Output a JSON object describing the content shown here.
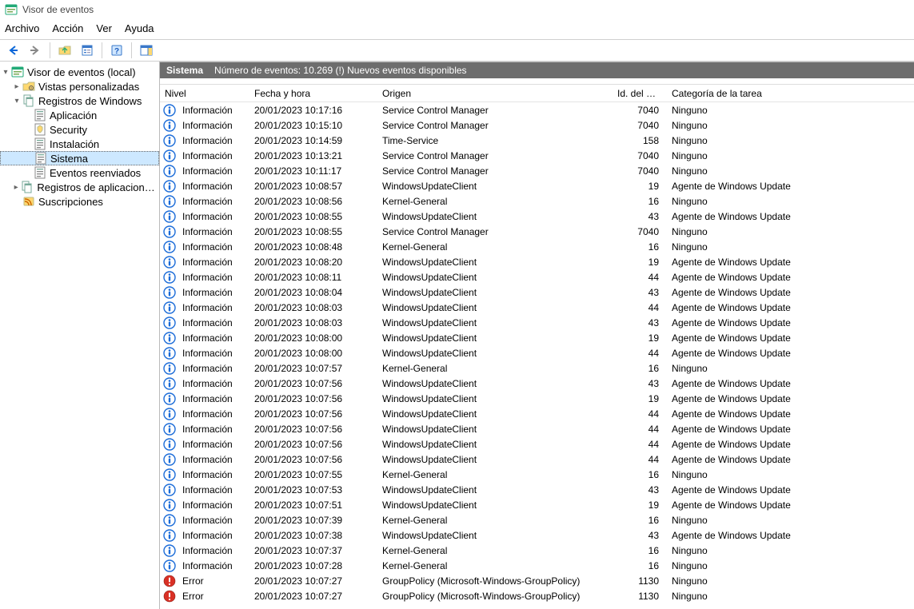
{
  "window": {
    "title": "Visor de eventos"
  },
  "menu": {
    "file": "Archivo",
    "action": "Acción",
    "view": "Ver",
    "help": "Ayuda"
  },
  "tree": {
    "root": "Visor de eventos (local)",
    "custom_views": "Vistas personalizadas",
    "windows_logs": "Registros de Windows",
    "application": "Aplicación",
    "security": "Security",
    "setup": "Instalación",
    "system": "Sistema",
    "forwarded": "Eventos reenviados",
    "app_services": "Registros de aplicaciones y s",
    "subscriptions": "Suscripciones"
  },
  "list_header": {
    "title": "Sistema",
    "count": "Número de eventos: 10.269 (!) Nuevos eventos disponibles"
  },
  "columns": {
    "level": "Nivel",
    "date": "Fecha y hora",
    "origin": "Origen",
    "event_id": "Id. del ev...",
    "category": "Categoría de la tarea"
  },
  "level_labels": {
    "info": "Información",
    "error": "Error"
  },
  "events": [
    {
      "lvl": "info",
      "date": "20/01/2023 10:17:16",
      "origin": "Service Control Manager",
      "id": "7040",
      "cat": "Ninguno"
    },
    {
      "lvl": "info",
      "date": "20/01/2023 10:15:10",
      "origin": "Service Control Manager",
      "id": "7040",
      "cat": "Ninguno"
    },
    {
      "lvl": "info",
      "date": "20/01/2023 10:14:59",
      "origin": "Time-Service",
      "id": "158",
      "cat": "Ninguno"
    },
    {
      "lvl": "info",
      "date": "20/01/2023 10:13:21",
      "origin": "Service Control Manager",
      "id": "7040",
      "cat": "Ninguno"
    },
    {
      "lvl": "info",
      "date": "20/01/2023 10:11:17",
      "origin": "Service Control Manager",
      "id": "7040",
      "cat": "Ninguno"
    },
    {
      "lvl": "info",
      "date": "20/01/2023 10:08:57",
      "origin": "WindowsUpdateClient",
      "id": "19",
      "cat": "Agente de Windows Update"
    },
    {
      "lvl": "info",
      "date": "20/01/2023 10:08:56",
      "origin": "Kernel-General",
      "id": "16",
      "cat": "Ninguno"
    },
    {
      "lvl": "info",
      "date": "20/01/2023 10:08:55",
      "origin": "WindowsUpdateClient",
      "id": "43",
      "cat": "Agente de Windows Update"
    },
    {
      "lvl": "info",
      "date": "20/01/2023 10:08:55",
      "origin": "Service Control Manager",
      "id": "7040",
      "cat": "Ninguno"
    },
    {
      "lvl": "info",
      "date": "20/01/2023 10:08:48",
      "origin": "Kernel-General",
      "id": "16",
      "cat": "Ninguno"
    },
    {
      "lvl": "info",
      "date": "20/01/2023 10:08:20",
      "origin": "WindowsUpdateClient",
      "id": "19",
      "cat": "Agente de Windows Update"
    },
    {
      "lvl": "info",
      "date": "20/01/2023 10:08:11",
      "origin": "WindowsUpdateClient",
      "id": "44",
      "cat": "Agente de Windows Update"
    },
    {
      "lvl": "info",
      "date": "20/01/2023 10:08:04",
      "origin": "WindowsUpdateClient",
      "id": "43",
      "cat": "Agente de Windows Update"
    },
    {
      "lvl": "info",
      "date": "20/01/2023 10:08:03",
      "origin": "WindowsUpdateClient",
      "id": "44",
      "cat": "Agente de Windows Update"
    },
    {
      "lvl": "info",
      "date": "20/01/2023 10:08:03",
      "origin": "WindowsUpdateClient",
      "id": "43",
      "cat": "Agente de Windows Update"
    },
    {
      "lvl": "info",
      "date": "20/01/2023 10:08:00",
      "origin": "WindowsUpdateClient",
      "id": "19",
      "cat": "Agente de Windows Update"
    },
    {
      "lvl": "info",
      "date": "20/01/2023 10:08:00",
      "origin": "WindowsUpdateClient",
      "id": "44",
      "cat": "Agente de Windows Update"
    },
    {
      "lvl": "info",
      "date": "20/01/2023 10:07:57",
      "origin": "Kernel-General",
      "id": "16",
      "cat": "Ninguno"
    },
    {
      "lvl": "info",
      "date": "20/01/2023 10:07:56",
      "origin": "WindowsUpdateClient",
      "id": "43",
      "cat": "Agente de Windows Update"
    },
    {
      "lvl": "info",
      "date": "20/01/2023 10:07:56",
      "origin": "WindowsUpdateClient",
      "id": "19",
      "cat": "Agente de Windows Update"
    },
    {
      "lvl": "info",
      "date": "20/01/2023 10:07:56",
      "origin": "WindowsUpdateClient",
      "id": "44",
      "cat": "Agente de Windows Update"
    },
    {
      "lvl": "info",
      "date": "20/01/2023 10:07:56",
      "origin": "WindowsUpdateClient",
      "id": "44",
      "cat": "Agente de Windows Update"
    },
    {
      "lvl": "info",
      "date": "20/01/2023 10:07:56",
      "origin": "WindowsUpdateClient",
      "id": "44",
      "cat": "Agente de Windows Update"
    },
    {
      "lvl": "info",
      "date": "20/01/2023 10:07:56",
      "origin": "WindowsUpdateClient",
      "id": "44",
      "cat": "Agente de Windows Update"
    },
    {
      "lvl": "info",
      "date": "20/01/2023 10:07:55",
      "origin": "Kernel-General",
      "id": "16",
      "cat": "Ninguno"
    },
    {
      "lvl": "info",
      "date": "20/01/2023 10:07:53",
      "origin": "WindowsUpdateClient",
      "id": "43",
      "cat": "Agente de Windows Update"
    },
    {
      "lvl": "info",
      "date": "20/01/2023 10:07:51",
      "origin": "WindowsUpdateClient",
      "id": "19",
      "cat": "Agente de Windows Update"
    },
    {
      "lvl": "info",
      "date": "20/01/2023 10:07:39",
      "origin": "Kernel-General",
      "id": "16",
      "cat": "Ninguno"
    },
    {
      "lvl": "info",
      "date": "20/01/2023 10:07:38",
      "origin": "WindowsUpdateClient",
      "id": "43",
      "cat": "Agente de Windows Update"
    },
    {
      "lvl": "info",
      "date": "20/01/2023 10:07:37",
      "origin": "Kernel-General",
      "id": "16",
      "cat": "Ninguno"
    },
    {
      "lvl": "info",
      "date": "20/01/2023 10:07:28",
      "origin": "Kernel-General",
      "id": "16",
      "cat": "Ninguno"
    },
    {
      "lvl": "error",
      "date": "20/01/2023 10:07:27",
      "origin": "GroupPolicy (Microsoft-Windows-GroupPolicy)",
      "id": "1130",
      "cat": "Ninguno"
    },
    {
      "lvl": "error",
      "date": "20/01/2023 10:07:27",
      "origin": "GroupPolicy (Microsoft-Windows-GroupPolicy)",
      "id": "1130",
      "cat": "Ninguno"
    }
  ]
}
